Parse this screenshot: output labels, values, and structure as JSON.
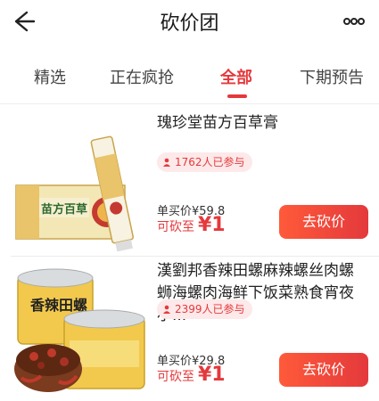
{
  "header": {
    "title": "砍价团",
    "back_icon": "arrow-left-icon",
    "more_icon": "more-dots-icon"
  },
  "tabs": [
    {
      "label": "精选",
      "active": false
    },
    {
      "label": "正在疯抢",
      "active": false
    },
    {
      "label": "全部",
      "active": true
    },
    {
      "label": "下期预告",
      "active": false
    }
  ],
  "products": [
    {
      "title": "瑰珍堂苗方百草膏",
      "participants": "1762人已参与",
      "price_line": "单买价¥59.8",
      "cut_prefix": "可砍至",
      "cut_value": "¥1",
      "button": "去砍价",
      "box_text": "苗方百草"
    },
    {
      "title": "漢劉邦香辣田螺麻辣螺丝肉螺蛳海螺肉海鲜下饭菜熟食宵夜小...",
      "participants": "2399人已参与",
      "price_line": "单买价¥29.8",
      "cut_prefix": "可砍至",
      "cut_value": "¥1",
      "button": "去砍价",
      "can_text": "香辣田螺"
    }
  ],
  "colors": {
    "accent": "#e4393c",
    "badge_bg": "#fde9e9"
  }
}
